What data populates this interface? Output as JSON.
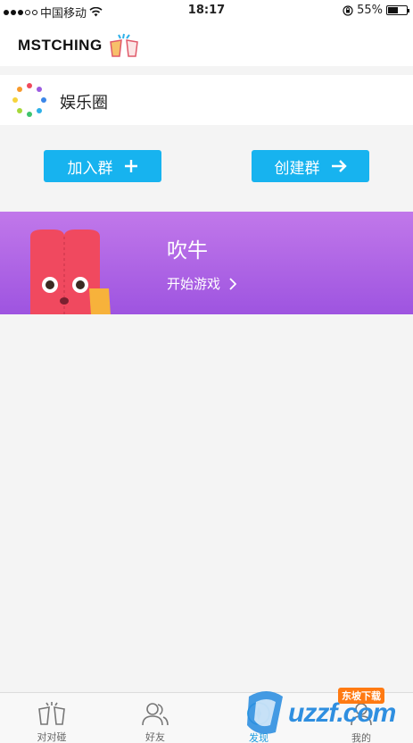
{
  "status_bar": {
    "carrier": "中国移动",
    "time": "18:17",
    "battery_percent_label": "55%",
    "battery_level": 0.55
  },
  "header": {
    "logo_text": "MSTCHING"
  },
  "section": {
    "title": "娱乐圈"
  },
  "actions": {
    "join_label": "加入群",
    "create_label": "创建群"
  },
  "game": {
    "title": "吹牛",
    "start_label": "开始游戏"
  },
  "tabs": [
    {
      "label": "对对碰",
      "icon": "couple-icon"
    },
    {
      "label": "好友",
      "icon": "friends-icon"
    },
    {
      "label": "发现",
      "icon": "discover-icon",
      "active": true
    },
    {
      "label": "我的",
      "icon": "profile-icon"
    }
  ],
  "watermark": {
    "text": "uzzf.com",
    "badge": "东坡下载"
  },
  "colors": {
    "accent": "#17b3ef",
    "banner_top": "#c178ea",
    "banner_bottom": "#9e54e0",
    "mascot": "#f0495f",
    "active_tab": "#1a9be0"
  }
}
